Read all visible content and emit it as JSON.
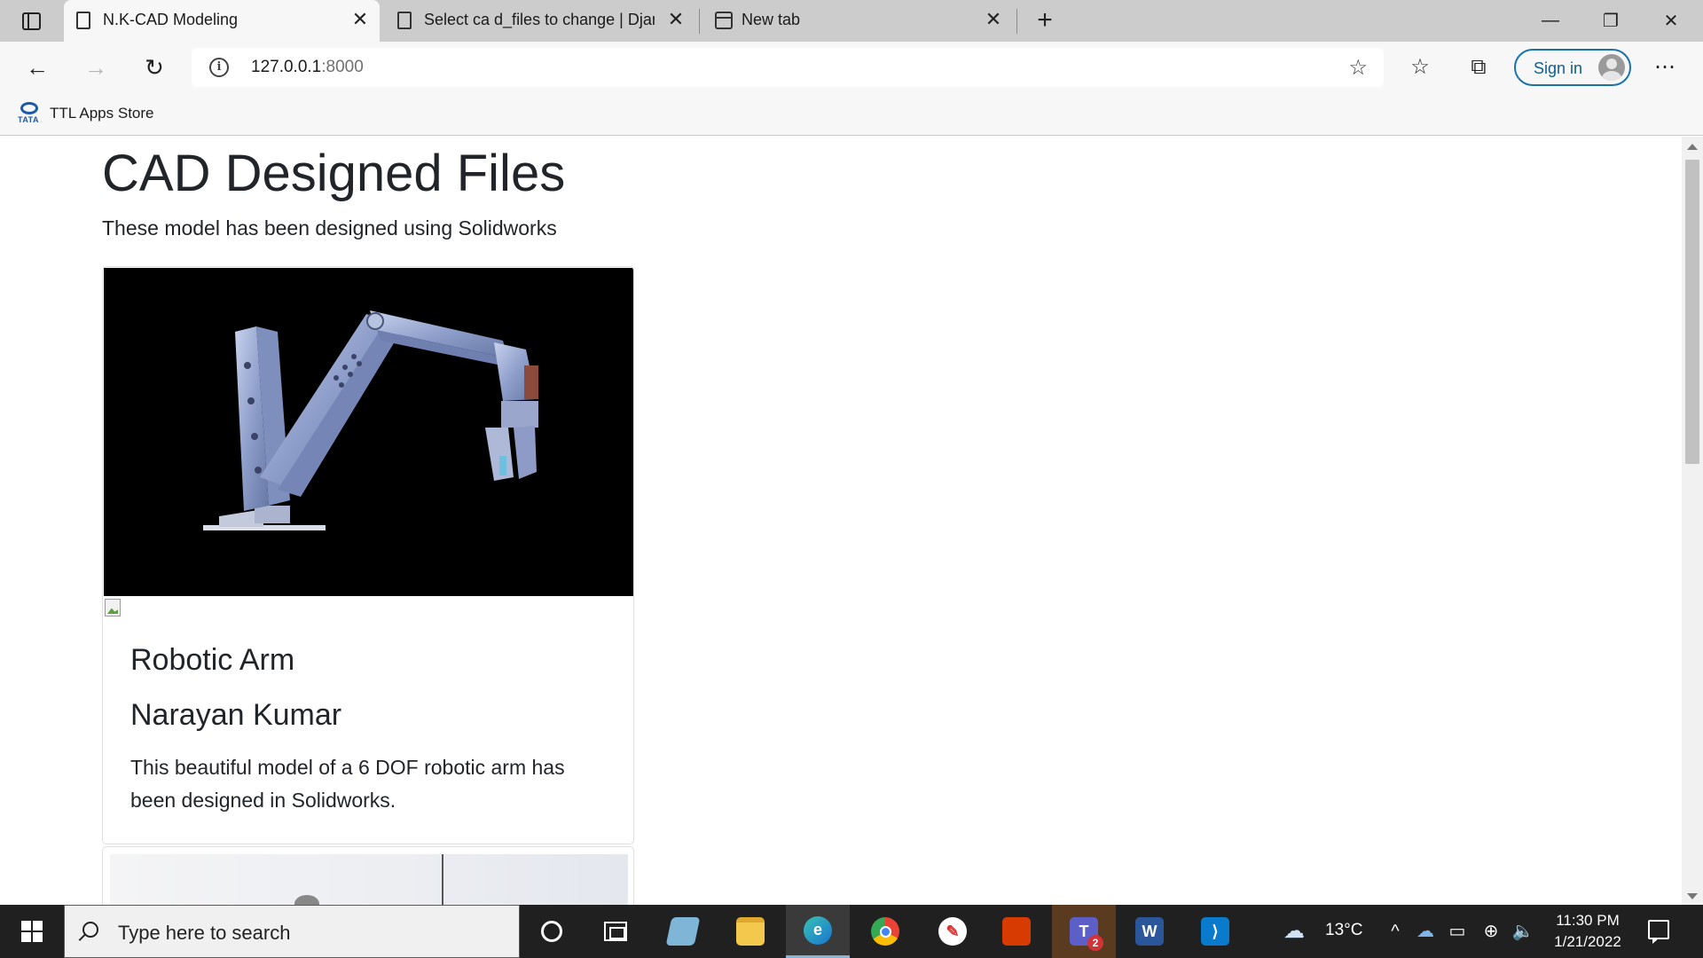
{
  "browser": {
    "tabs": [
      {
        "title": "N.K-CAD Modeling",
        "active": true
      },
      {
        "title": "Select ca d_files to change | Djan",
        "active": false
      },
      {
        "title": "New tab",
        "active": false
      }
    ],
    "new_tab_symbol": "+",
    "window_controls": {
      "minimize": "—",
      "restore": "❐",
      "close": "✕"
    },
    "address": {
      "host": "127.0.0.1",
      "port": ":8000"
    },
    "sign_in_label": "Sign in",
    "bookmarks": [
      {
        "label": "TTL Apps Store",
        "logo_text": "TATA"
      }
    ]
  },
  "page": {
    "title": "CAD Designed Files",
    "subtitle": "These model has been designed using Solidworks",
    "cards": [
      {
        "title": "Robotic Arm",
        "author": "Narayan Kumar",
        "description": "This beautiful model of a 6 DOF robotic arm has been designed in Solidworks.",
        "image_subject": "robotic-arm-render"
      }
    ]
  },
  "taskbar": {
    "search_placeholder": "Type here to search",
    "weather_temp": "13°C",
    "time": "11:30 PM",
    "date": "1/21/2022",
    "teams_badge": "2",
    "apps": [
      "cortana",
      "task-view",
      "notepad-app",
      "file-explorer",
      "edge",
      "chrome",
      "paint-app",
      "office",
      "teams",
      "word",
      "vscode"
    ]
  },
  "colors": {
    "tabbar_bg": "#cccccc",
    "toolbar_bg": "#f7f7f7",
    "accent": "#1a73a8",
    "taskbar_bg": "#202020",
    "text": "#212529"
  }
}
